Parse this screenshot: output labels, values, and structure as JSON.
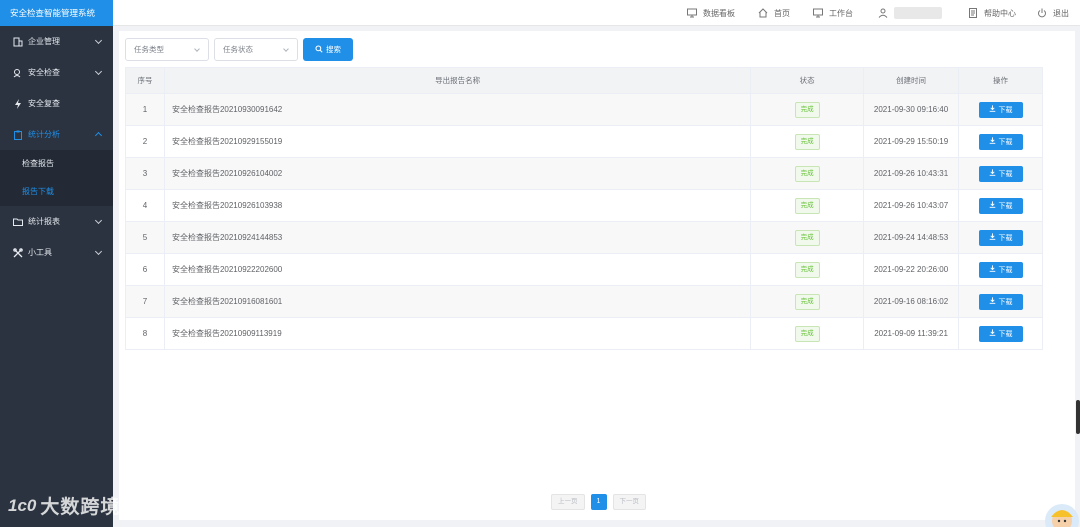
{
  "app": {
    "title": "安全检查智能管理系统"
  },
  "sidebar": {
    "items": [
      {
        "label": "企业管理"
      },
      {
        "label": "安全检查"
      },
      {
        "label": "安全复查"
      },
      {
        "label": "统计分析"
      },
      {
        "label": "统计报表"
      },
      {
        "label": "小工具"
      }
    ],
    "subitems": [
      {
        "label": "检查报告"
      },
      {
        "label": "报告下载"
      }
    ]
  },
  "topbar": {
    "dashboard": "数据看板",
    "home": "首页",
    "workbench": "工作台",
    "help": "帮助中心",
    "logout": "退出"
  },
  "filters": {
    "task_type": "任务类型",
    "task_status": "任务状态",
    "search_label": "搜索"
  },
  "table": {
    "headers": [
      "序号",
      "导出报告名称",
      "状态",
      "创建时间",
      "操作"
    ],
    "rows": [
      {
        "no": "1",
        "name": "安全检查报告20210930091642",
        "status": "完成",
        "time": "2021-09-30 09:16:40",
        "action": "下载"
      },
      {
        "no": "2",
        "name": "安全检查报告20210929155019",
        "status": "完成",
        "time": "2021-09-29 15:50:19",
        "action": "下载"
      },
      {
        "no": "3",
        "name": "安全检查报告20210926104002",
        "status": "完成",
        "time": "2021-09-26 10:43:31",
        "action": "下载"
      },
      {
        "no": "4",
        "name": "安全检查报告20210926103938",
        "status": "完成",
        "time": "2021-09-26 10:43:07",
        "action": "下载"
      },
      {
        "no": "5",
        "name": "安全检查报告20210924144853",
        "status": "完成",
        "time": "2021-09-24 14:48:53",
        "action": "下载"
      },
      {
        "no": "6",
        "name": "安全检查报告20210922202600",
        "status": "完成",
        "time": "2021-09-22 20:26:00",
        "action": "下载"
      },
      {
        "no": "7",
        "name": "安全检查报告20210916081601",
        "status": "完成",
        "time": "2021-09-16 08:16:02",
        "action": "下载"
      },
      {
        "no": "8",
        "name": "安全检查报告20210909113919",
        "status": "完成",
        "time": "2021-09-09 11:39:21",
        "action": "下载"
      }
    ]
  },
  "pagination": {
    "prev": "上一页",
    "current": "1",
    "next": "下一页"
  },
  "watermark": {
    "text": "大数跨境",
    "logo": "1c0"
  },
  "colors": {
    "accent": "#1f8fe8",
    "sidebar": "#2b3340",
    "success": "#67c23a"
  }
}
